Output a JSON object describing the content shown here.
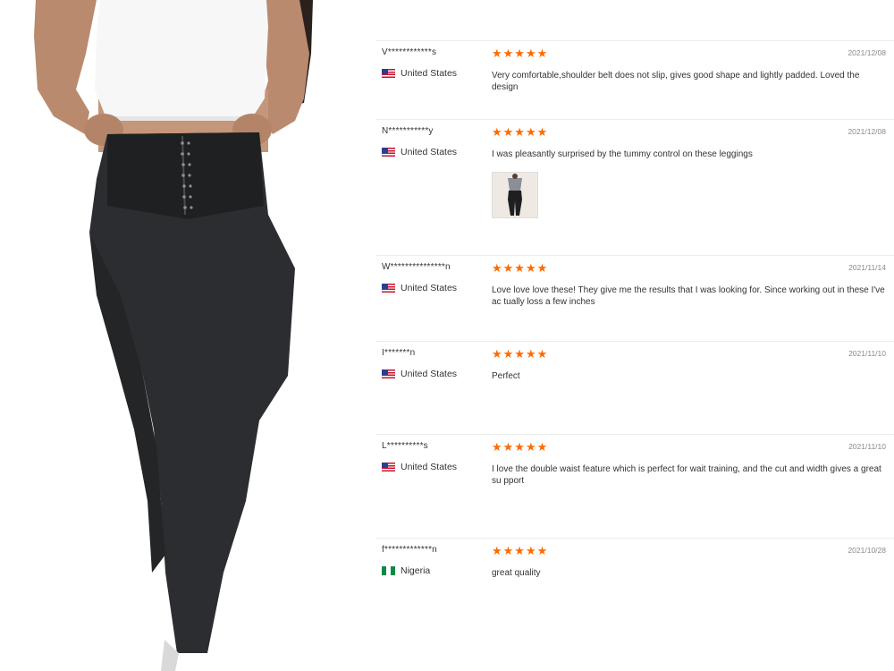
{
  "reviews": [
    {
      "user": "V************s",
      "country": "United States",
      "flag": "us",
      "stars": "★★★★★",
      "date": "2021/12/08",
      "text": "Very comfortable,shoulder belt does not slip, gives good shape and lightly padded. Loved the design",
      "has_photo": false
    },
    {
      "user": "N***********y",
      "country": "United States",
      "flag": "us",
      "stars": "★★★★★",
      "date": "2021/12/08",
      "text": "I was pleasantly surprised by the tummy control on these leggings",
      "has_photo": true
    },
    {
      "user": "W***************n",
      "country": "United States",
      "flag": "us",
      "stars": "★★★★★",
      "date": "2021/11/14",
      "text": "Love love love these! They give me the results that I was looking for. Since working out in these I've ac tually loss a few inches",
      "has_photo": false
    },
    {
      "user": "I*******n",
      "country": "United States",
      "flag": "us",
      "stars": "★★★★★",
      "date": "2021/11/10",
      "text": "Perfect",
      "has_photo": false
    },
    {
      "user": "L**********s",
      "country": "United States",
      "flag": "us",
      "stars": "★★★★★",
      "date": "2021/11/10",
      "text": "I love the double waist feature which is perfect for wait training, and the cut and width gives a great su pport",
      "has_photo": false
    },
    {
      "user": "f*************n",
      "country": "Nigeria",
      "flag": "ng",
      "stars": "★★★★★",
      "date": "2021/10/28",
      "text": "great quality",
      "has_photo": false
    }
  ],
  "colors": {
    "star": "#ff6a00",
    "divider": "#ececec",
    "text": "#333333",
    "date": "#8a8a8a"
  }
}
